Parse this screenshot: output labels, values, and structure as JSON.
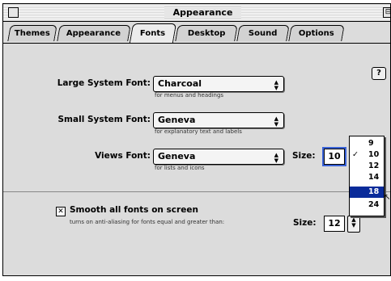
{
  "window": {
    "title": "Appearance"
  },
  "tabs": [
    "Themes",
    "Appearance",
    "Fonts",
    "Desktop",
    "Sound",
    "Options"
  ],
  "active_tab": "Fonts",
  "help_icon": "?",
  "fonts": {
    "large": {
      "label": "Large System Font:",
      "value": "Charcoal",
      "hint": "for menus and headings"
    },
    "small": {
      "label": "Small System Font:",
      "value": "Geneva",
      "hint": "for explanatory text and labels"
    },
    "views": {
      "label": "Views Font:",
      "value": "Geneva",
      "hint": "for lists and icons",
      "size_label": "Size:",
      "size_value": "10"
    }
  },
  "size_menu": {
    "items": [
      "9",
      "10",
      "12",
      "14",
      "18",
      "24"
    ],
    "checked": "10",
    "highlighted": "18"
  },
  "smoothing": {
    "label": "Smooth all fonts on screen",
    "hint": "turns on anti-aliasing for fonts equal and greater than:",
    "size_label": "Size:",
    "size_value": "12",
    "checked": true
  },
  "glyphs": {
    "arrows": "▲▼",
    "check": "✓",
    "checkbox_mark": "✕",
    "zoom": "⊟",
    "cursor": "↖"
  }
}
